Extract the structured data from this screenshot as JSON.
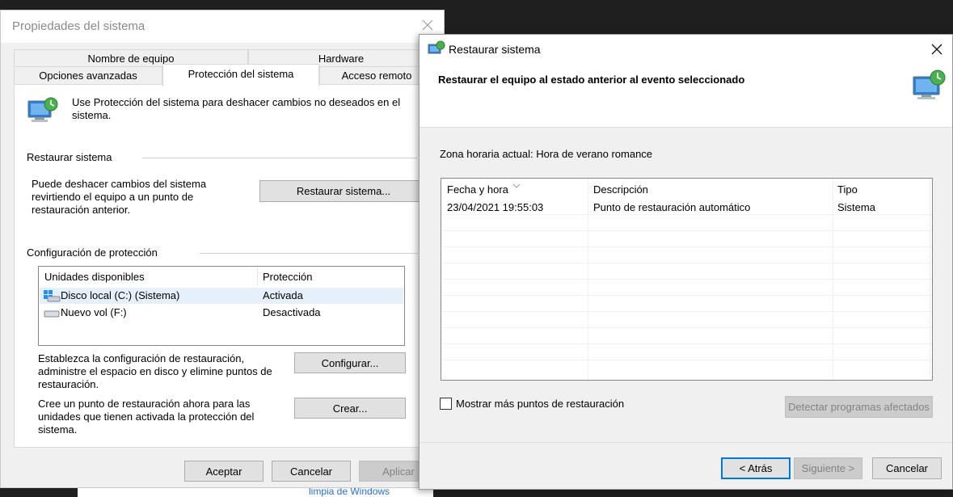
{
  "background_text": "limpia de Windows",
  "sys_props": {
    "title": "Propiedades del sistema",
    "tabs_top": [
      "Nombre de equipo",
      "Hardware"
    ],
    "tabs_bottom": [
      "Opciones avanzadas",
      "Protección del sistema",
      "Acceso remoto"
    ],
    "intro": "Use Protección del sistema para deshacer cambios no deseados en el sistema.",
    "restore_heading": "Restaurar sistema",
    "restore_desc": "Puede deshacer cambios del sistema revirtiendo el equipo a un punto de restauración anterior.",
    "restore_button": "Restaurar sistema...",
    "config_heading": "Configuración de protección",
    "drives_columns": [
      "Unidades disponibles",
      "Protección"
    ],
    "drives": [
      {
        "name": "Disco local (C:) (Sistema)",
        "status": "Activada"
      },
      {
        "name": "Nuevo vol (F:)",
        "status": "Desactivada"
      }
    ],
    "configure_desc": "Establezca la configuración de restauración, administre el espacio en disco y elimine puntos de restauración.",
    "configure_button": "Configurar...",
    "create_desc": "Cree un punto de restauración ahora para las unidades que tienen activada la protección del sistema.",
    "create_button": "Crear...",
    "ok_button": "Aceptar",
    "cancel_button": "Cancelar",
    "apply_button": "Aplicar"
  },
  "restore": {
    "title": "Restaurar sistema",
    "header": "Restaurar el equipo al estado anterior al evento seleccionado",
    "timezone": "Zona horaria actual: Hora de verano romance",
    "columns": [
      "Fecha y hora",
      "Descripción",
      "Tipo"
    ],
    "rows": [
      {
        "date": "23/04/2021 19:55:03",
        "desc": "Punto de restauración automático",
        "type": "Sistema"
      }
    ],
    "show_more_label": "Mostrar más puntos de restauración",
    "detect_button": "Detectar programas afectados",
    "back_button": "< Atrás",
    "next_button": "Siguiente >",
    "cancel_button": "Cancelar"
  }
}
